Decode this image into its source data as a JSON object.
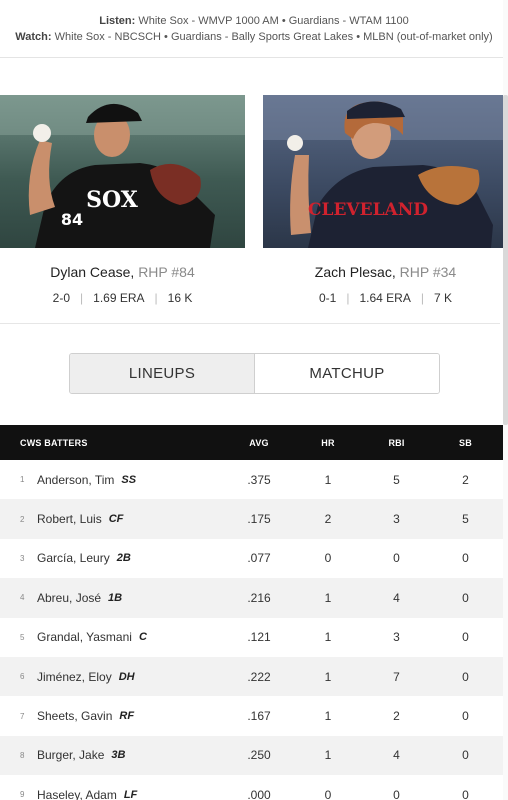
{
  "broadcast": {
    "listen_label": "Listen:",
    "listen_text": "White Sox - WMVP 1000 AM • Guardians - WTAM 1100",
    "watch_label": "Watch:",
    "watch_text": "White Sox - NBCSCH • Guardians - Bally Sports Great Lakes • MLBN (out-of-market only)"
  },
  "pitchers": [
    {
      "name": "Dylan Cease,",
      "role": "RHP #84",
      "record": "2-0",
      "era": "1.69 ERA",
      "k": "16 K",
      "jersey_text": "SOX",
      "number_text": "84"
    },
    {
      "name": "Zach Plesac,",
      "role": "RHP #34",
      "record": "0-1",
      "era": "1.64 ERA",
      "k": "7 K",
      "jersey_text": "CLEVELAND"
    }
  ],
  "tabs": [
    {
      "label": "LINEUPS",
      "active": true
    },
    {
      "label": "MATCHUP",
      "active": false
    }
  ],
  "table": {
    "headers": {
      "name": "CWS BATTERS",
      "avg": "AVG",
      "hr": "HR",
      "rbi": "RBI",
      "sb": "SB"
    },
    "rows": [
      {
        "num": "1",
        "name": "Anderson, Tim",
        "pos": "SS",
        "avg": ".375",
        "hr": "1",
        "rbi": "5",
        "sb": "2"
      },
      {
        "num": "2",
        "name": "Robert, Luis",
        "pos": "CF",
        "avg": ".175",
        "hr": "2",
        "rbi": "3",
        "sb": "5"
      },
      {
        "num": "3",
        "name": "García, Leury",
        "pos": "2B",
        "avg": ".077",
        "hr": "0",
        "rbi": "0",
        "sb": "0"
      },
      {
        "num": "4",
        "name": "Abreu, José",
        "pos": "1B",
        "avg": ".216",
        "hr": "1",
        "rbi": "4",
        "sb": "0"
      },
      {
        "num": "5",
        "name": "Grandal, Yasmani",
        "pos": "C",
        "avg": ".121",
        "hr": "1",
        "rbi": "3",
        "sb": "0"
      },
      {
        "num": "6",
        "name": "Jiménez, Eloy",
        "pos": "DH",
        "avg": ".222",
        "hr": "1",
        "rbi": "7",
        "sb": "0"
      },
      {
        "num": "7",
        "name": "Sheets, Gavin",
        "pos": "RF",
        "avg": ".167",
        "hr": "1",
        "rbi": "2",
        "sb": "0"
      },
      {
        "num": "8",
        "name": "Burger, Jake",
        "pos": "3B",
        "avg": ".250",
        "hr": "1",
        "rbi": "4",
        "sb": "0"
      },
      {
        "num": "9",
        "name": "Haseley, Adam",
        "pos": "LF",
        "avg": ".000",
        "hr": "0",
        "rbi": "0",
        "sb": "0"
      }
    ]
  }
}
